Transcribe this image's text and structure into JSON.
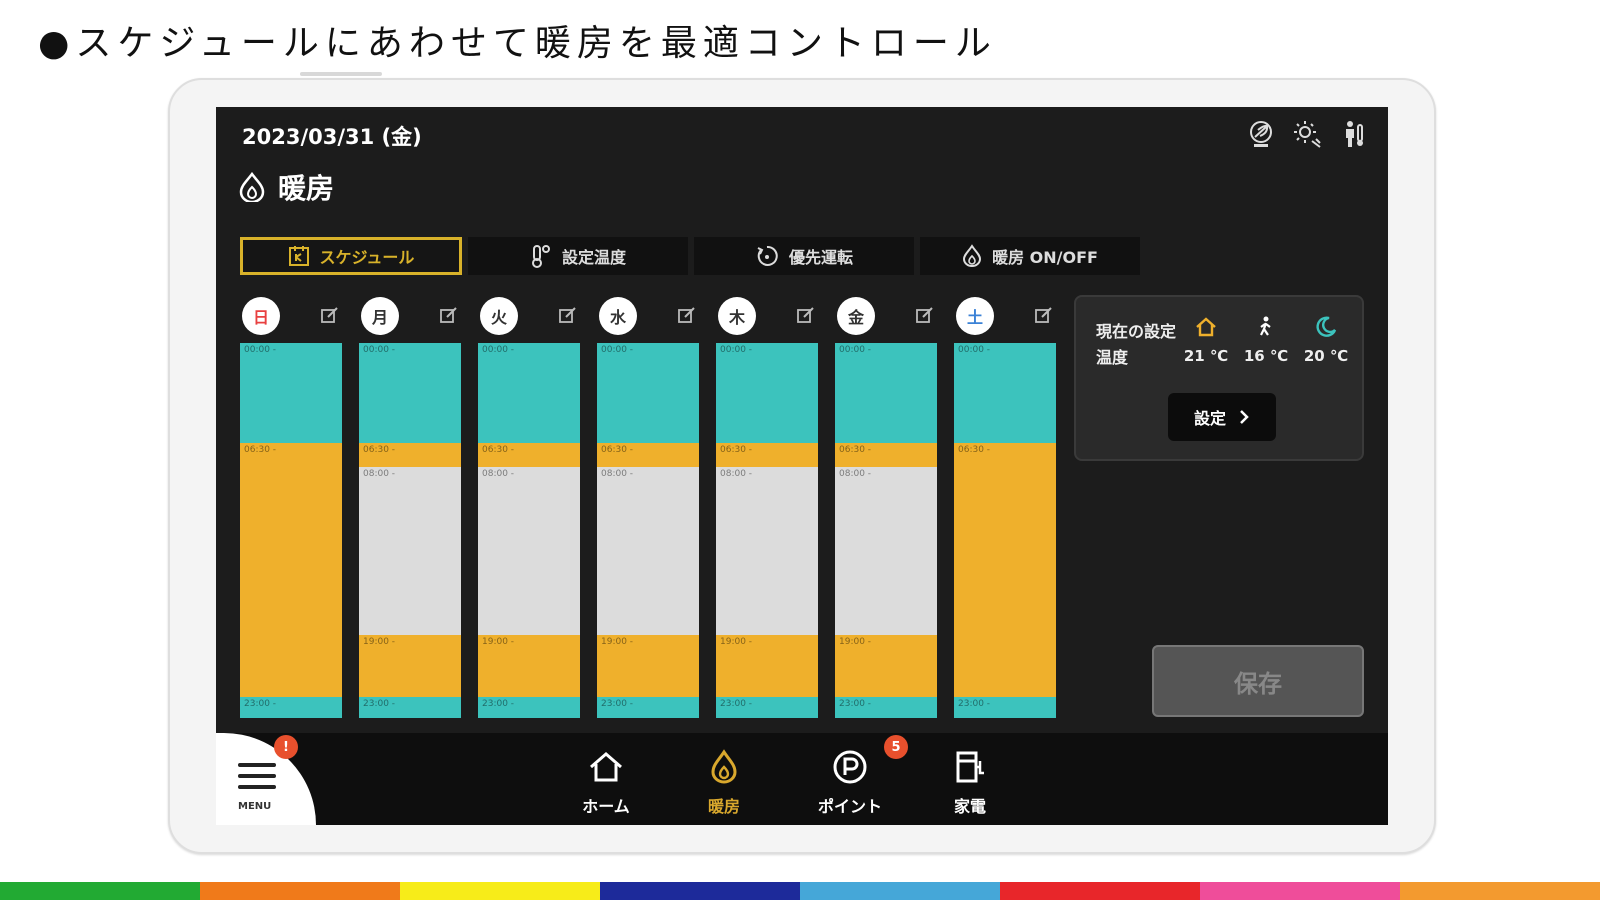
{
  "headline": "●スケジュールにあわせて暖房を最適コントロール",
  "header": {
    "date": "2023/03/31 (金)",
    "title": "暖房",
    "icons": [
      "eco-leaf-icon",
      "sun-auto-icon",
      "person-thermometer-icon"
    ]
  },
  "tabs": [
    {
      "label": "スケジュール",
      "icon": "schedule-icon",
      "active": true
    },
    {
      "label": "設定温度",
      "icon": "thermometer-icon",
      "active": false
    },
    {
      "label": "優先運転",
      "icon": "priority-icon",
      "active": false
    },
    {
      "label": "暖房 ON/OFF",
      "icon": "flame-icon",
      "active": false
    }
  ],
  "days": [
    {
      "label": "日",
      "color": "#e84040",
      "segments": [
        {
          "start": "00:00 -",
          "mode": "home"
        },
        {
          "start": "06:30 -",
          "mode": "wake"
        },
        {
          "start": "23:00 -",
          "mode": "home"
        }
      ]
    },
    {
      "label": "月",
      "color": "#333333",
      "segments": [
        {
          "start": "00:00 -",
          "mode": "home"
        },
        {
          "start": "06:30 -",
          "mode": "wake"
        },
        {
          "start": "08:00 -",
          "mode": "away"
        },
        {
          "start": "19:00 -",
          "mode": "wake"
        },
        {
          "start": "23:00 -",
          "mode": "home"
        }
      ]
    },
    {
      "label": "火",
      "color": "#333333",
      "segments": [
        {
          "start": "00:00 -",
          "mode": "home"
        },
        {
          "start": "06:30 -",
          "mode": "wake"
        },
        {
          "start": "08:00 -",
          "mode": "away"
        },
        {
          "start": "19:00 -",
          "mode": "wake"
        },
        {
          "start": "23:00 -",
          "mode": "home"
        }
      ]
    },
    {
      "label": "水",
      "color": "#333333",
      "segments": [
        {
          "start": "00:00 -",
          "mode": "home"
        },
        {
          "start": "06:30 -",
          "mode": "wake"
        },
        {
          "start": "08:00 -",
          "mode": "away"
        },
        {
          "start": "19:00 -",
          "mode": "wake"
        },
        {
          "start": "23:00 -",
          "mode": "home"
        }
      ]
    },
    {
      "label": "木",
      "color": "#333333",
      "segments": [
        {
          "start": "00:00 -",
          "mode": "home"
        },
        {
          "start": "06:30 -",
          "mode": "wake"
        },
        {
          "start": "08:00 -",
          "mode": "away"
        },
        {
          "start": "19:00 -",
          "mode": "wake"
        },
        {
          "start": "23:00 -",
          "mode": "home"
        }
      ]
    },
    {
      "label": "金",
      "color": "#333333",
      "segments": [
        {
          "start": "00:00 -",
          "mode": "home"
        },
        {
          "start": "06:30 -",
          "mode": "wake"
        },
        {
          "start": "08:00 -",
          "mode": "away"
        },
        {
          "start": "19:00 -",
          "mode": "wake"
        },
        {
          "start": "23:00 -",
          "mode": "home"
        }
      ]
    },
    {
      "label": "土",
      "color": "#3b82d6",
      "segments": [
        {
          "start": "00:00 -",
          "mode": "home"
        },
        {
          "start": "06:30 -",
          "mode": "wake"
        },
        {
          "start": "23:00 -",
          "mode": "home"
        }
      ]
    }
  ],
  "mode_colors": {
    "home": "#3cc3bd",
    "wake": "#efb02c",
    "away": "#dcdcdc"
  },
  "current_settings": {
    "label": "現在の設定温度",
    "temps": [
      {
        "icon": "home-icon",
        "color": "#efb02c",
        "value": "21 ℃"
      },
      {
        "icon": "walking-person-icon",
        "color": "#ffffff",
        "value": "16 ℃"
      },
      {
        "icon": "moon-icon",
        "color": "#3cc3bd",
        "value": "20 ℃"
      }
    ],
    "set_button": "設定"
  },
  "save_button": "保存",
  "bottom_nav": {
    "menu_label": "MENU",
    "menu_badge": "!",
    "items": [
      {
        "label": "ホーム",
        "icon": "house-icon",
        "active": false
      },
      {
        "label": "暖房",
        "icon": "flame-icon",
        "active": true
      },
      {
        "label": "ポイント",
        "icon": "point-icon",
        "active": false,
        "badge": "5"
      },
      {
        "label": "家電",
        "icon": "appliance-icon",
        "active": false
      }
    ]
  },
  "stripe_colors": [
    "#22aa33",
    "#f07a1a",
    "#f7ec19",
    "#1d2a9a",
    "#45a7d8",
    "#e8262a",
    "#ef4d9a",
    "#f39a2f"
  ]
}
